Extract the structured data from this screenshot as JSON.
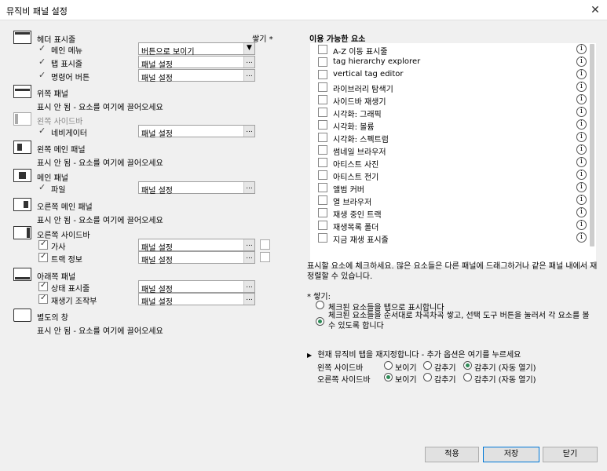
{
  "window": {
    "title": "뮤직비 패널 설정",
    "close_glyph": "✕"
  },
  "left": {
    "stack_header": "쌓기 *",
    "header_section": {
      "title": "헤더 표시줄",
      "rows": [
        {
          "label": "메인 메뉴",
          "value": "버튼으로 보이기",
          "button": "▼"
        },
        {
          "label": "탭 표시줄",
          "value": "패널 설정",
          "button": "..."
        },
        {
          "label": "명령어 버튼",
          "value": "패널 설정",
          "button": "..."
        }
      ]
    },
    "top_panel": {
      "title": "위쪽 패널",
      "empty": "표시 안 됨 - 요소를 여기에 끌어오세요"
    },
    "left_sidebar": {
      "title": "왼쪽 사이드바",
      "rows": [
        {
          "label": "네비게이터",
          "value": "패널 설정",
          "button": "..."
        }
      ]
    },
    "left_main": {
      "title": "왼쪽 메인 패널",
      "empty": "표시 안 됨 - 요소를 여기에 끌어오세요"
    },
    "main_panel": {
      "title": "메인 패널",
      "rows": [
        {
          "label": "파일",
          "value": "패널 설정",
          "button": "..."
        }
      ]
    },
    "right_main": {
      "title": "오른쪽 메인 패널",
      "empty": "표시 안 됨 - 요소를 여기에 끌어오세요"
    },
    "right_sidebar": {
      "title": "오른쪽 사이드바",
      "rows": [
        {
          "label": "가사",
          "value": "패널 설정",
          "button": "..."
        },
        {
          "label": "트랙 정보",
          "value": "패널 설정",
          "button": "..."
        }
      ]
    },
    "bottom_panel": {
      "title": "아래쪽 패널",
      "rows": [
        {
          "label": "상태 표시줄",
          "value": "패널 설정",
          "button": "..."
        },
        {
          "label": "재생기 조작부",
          "value": "패널 설정",
          "button": "..."
        }
      ]
    },
    "separate_window": {
      "title": "별도의 창",
      "empty": "표시 안 됨 - 요소를 여기에 끌어오세요"
    }
  },
  "right": {
    "available_title": "이용 가능한 요소",
    "items": [
      "A-Z 이동 표시줄",
      "tag hierarchy explorer",
      "vertical tag editor",
      "라이브러리 탐색기",
      "사이드바 재생기",
      "시각화: 그래픽",
      "시각화: 볼륨",
      "시각화: 스펙트럼",
      "썸네일 브라우저",
      "아티스트 사진",
      "아티스트 전기",
      "앨범 커버",
      "열 브라우저",
      "재생 중인 트랙",
      "재생목록 폴더",
      "지금 재생 표시줄"
    ],
    "info_glyph": "i",
    "help_text": "표시할 요소에 체크하세요. 많은 요소들은 다른 패널에 드래그하거나 같은 패널 내에서 재정렬할 수 있습니다.",
    "stack_label": "* 쌓기:",
    "stack_opt1": "체크된 요소들을 탭으로 표시합니다",
    "stack_opt2": "체크된 요소들을 순서대로 차곡차곡 쌓고, 선택 도구 버튼을 눌러서 각 요소를 볼 수 있도록 합니다",
    "reset_text": "현재 뮤직비 탭을 재지정합니다 - 추가 옵션은 여기를 누르세요",
    "reset_arrow": "▶",
    "sidebar_rows": [
      {
        "label": "왼쪽 사이드바",
        "show": "보이기",
        "hide": "감추기",
        "auto": "감추기 (자동 열기)",
        "selected": "auto"
      },
      {
        "label": "오른쪽 사이드바",
        "show": "보이기",
        "hide": "감추기",
        "auto": "감추기 (자동 열기)",
        "selected": "show"
      }
    ]
  },
  "buttons": {
    "apply": "적용",
    "save": "저장",
    "close": "닫기"
  }
}
